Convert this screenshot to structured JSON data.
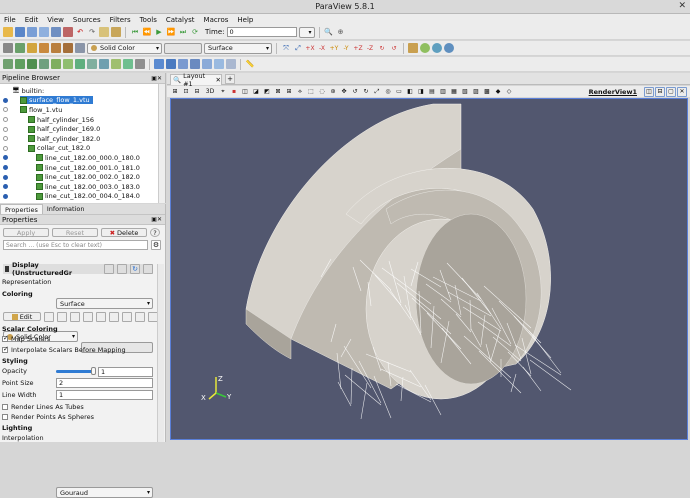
{
  "window": {
    "title": "ParaView 5.8.1"
  },
  "menu": [
    "File",
    "Edit",
    "View",
    "Sources",
    "Filters",
    "Tools",
    "Catalyst",
    "Macros",
    "Help"
  ],
  "toolbar1": {
    "time_label": "Time:",
    "time_value": "0"
  },
  "toolbar2": {
    "color_by": "Solid Color",
    "representation": "Surface"
  },
  "pipeline": {
    "title": "Pipeline Browser",
    "items": [
      {
        "label": "builtin:",
        "indent": 0
      },
      {
        "label": "surface_flow_1.vtu",
        "indent": 1,
        "selected": true
      },
      {
        "label": "flow_1.vtu",
        "indent": 1
      },
      {
        "label": "half_cylinder_156",
        "indent": 2
      },
      {
        "label": "half_cylinder_169.0",
        "indent": 2
      },
      {
        "label": "half_cylinder_182.0",
        "indent": 2
      },
      {
        "label": "collar_cut_182.0",
        "indent": 2
      },
      {
        "label": "line_cut_182.00_000.0_180.0",
        "indent": 3
      },
      {
        "label": "line_cut_182.00_001.0_181.0",
        "indent": 3
      },
      {
        "label": "line_cut_182.00_002.0_182.0",
        "indent": 3
      },
      {
        "label": "line_cut_182.00_003.0_183.0",
        "indent": 3
      },
      {
        "label": "line_cut_182.00_004.0_184.0",
        "indent": 3
      }
    ]
  },
  "tabs": {
    "properties": "Properties",
    "information": "Information"
  },
  "properties": {
    "title": "Properties",
    "apply": "Apply",
    "reset": "Reset",
    "delete": "Delete",
    "search_placeholder": "Search ... (use Esc to clear text)",
    "display_header": "Display (UnstructuredGr",
    "representation_label": "Representation",
    "representation_value": "Surface",
    "coloring_label": "Coloring",
    "coloring_value": "Solid Color",
    "edit_label": "Edit",
    "scalar_coloring": "Scalar Coloring",
    "map_scalars": "Map Scalars",
    "interpolate": "Interpolate Scalars Before Mapping",
    "styling": "Styling",
    "opacity_label": "Opacity",
    "opacity_value": "1",
    "opacity_level": 1,
    "point_size_label": "Point Size",
    "point_size_value": "2",
    "line_width_label": "Line Width",
    "line_width_value": "1",
    "lines_as_tubes": "Render Lines As Tubes",
    "points_as_spheres": "Render Points As Spheres",
    "lighting": "Lighting",
    "interpolation_label": "Interpolation",
    "interpolation_value": "Gouraud"
  },
  "layout": {
    "tab": "Layout #1",
    "add": "+",
    "view_name": "RenderView1",
    "mode_3d": "3D"
  },
  "axes": {
    "x": "X",
    "y": "Y",
    "z": "Z"
  },
  "colors": {
    "viewport_bg": "#52576f",
    "selection": "#2f7bd3",
    "surface": "#d7d3cc"
  }
}
